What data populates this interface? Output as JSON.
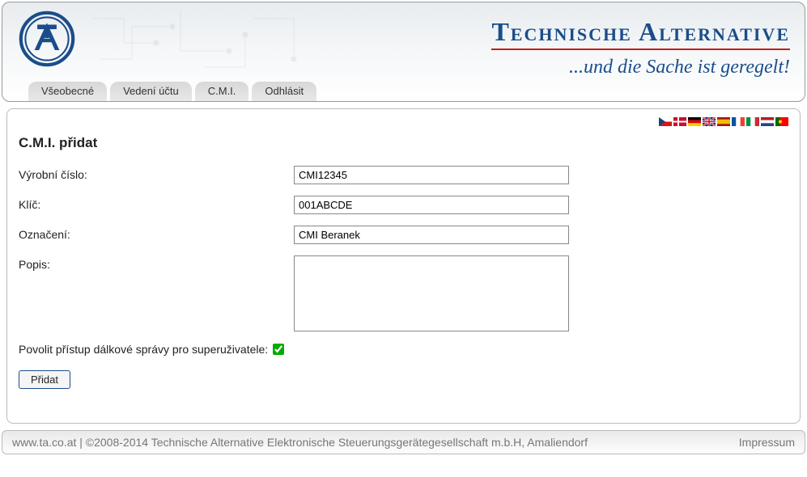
{
  "brand": {
    "title": "Technische Alternative",
    "slogan": "...und die Sache ist geregelt!"
  },
  "tabs": [
    {
      "label": "Všeobecné"
    },
    {
      "label": "Vedení účtu"
    },
    {
      "label": "C.M.I."
    },
    {
      "label": "Odhlásit"
    }
  ],
  "page_title": "C.M.I. přidat",
  "form": {
    "serial_label": "Výrobní číslo:",
    "serial_value": "CMI12345",
    "key_label": "Klíč:",
    "key_value": "001ABCDE",
    "name_label": "Označení:",
    "name_value": "CMI Beranek",
    "desc_label": "Popis:",
    "desc_value": "",
    "remote_label": "Povolit přístup dálkové správy pro superuživatele:",
    "submit_label": "Přidat"
  },
  "footer": {
    "link": "www.ta.co.at",
    "copyright": " | ©2008-2014 Technische Alternative Elektronische Steuerungsgerätegesellschaft m.b.H, Amaliendorf",
    "impressum": "Impressum"
  },
  "flags": [
    "cz",
    "dk",
    "de",
    "uk",
    "es",
    "fr",
    "it",
    "nl",
    "pt"
  ]
}
